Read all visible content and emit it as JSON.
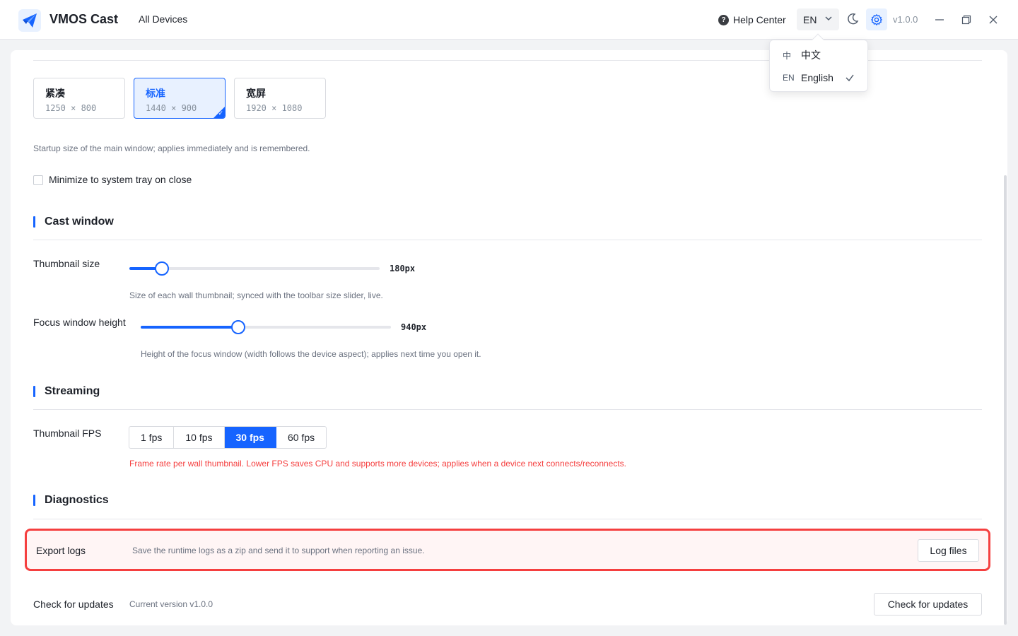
{
  "header": {
    "app_title": "VMOS Cast",
    "nav_all_devices": "All Devices",
    "help_center": "Help Center",
    "language_code": "EN",
    "version": "v1.0.0",
    "accent_color": "#1664ff"
  },
  "language_menu": {
    "items": [
      {
        "code": "中",
        "label": "中文",
        "selected": false
      },
      {
        "code": "EN",
        "label": "English",
        "selected": true
      }
    ]
  },
  "window_size": {
    "options": [
      {
        "name": "紧凑",
        "dimensions": "1250 × 800",
        "selected": false
      },
      {
        "name": "标准",
        "dimensions": "1440 × 900",
        "selected": true
      },
      {
        "name": "宽屏",
        "dimensions": "1920 × 1080",
        "selected": false
      }
    ],
    "hint": "Startup size of the main window; applies immediately and is remembered.",
    "tray_label": "Minimize to system tray on close",
    "tray_checked": false
  },
  "cast_window": {
    "title": "Cast window",
    "thumbnail_size": {
      "label": "Thumbnail size",
      "value": "180px",
      "fraction": 0.13,
      "hint": "Size of each wall thumbnail; synced with the toolbar size slider, live."
    },
    "focus_height": {
      "label": "Focus window height",
      "value": "940px",
      "fraction": 0.39,
      "hint": "Height of the focus window (width follows the device aspect); applies next time you open it."
    }
  },
  "streaming": {
    "title": "Streaming",
    "fps_label": "Thumbnail FPS",
    "options": [
      "1 fps",
      "10 fps",
      "30 fps",
      "60 fps"
    ],
    "selected": "30 fps",
    "warning": "Frame rate per wall thumbnail. Lower FPS saves CPU and supports more devices; applies when a device next connects/reconnects."
  },
  "diagnostics": {
    "title": "Diagnostics",
    "export_label": "Export logs",
    "export_desc": "Save the runtime logs as a zip and send it to support when reporting an issue.",
    "log_button": "Log files",
    "updates_label": "Check for updates",
    "current_version": "Current version v1.0.0",
    "updates_button": "Check for updates"
  }
}
